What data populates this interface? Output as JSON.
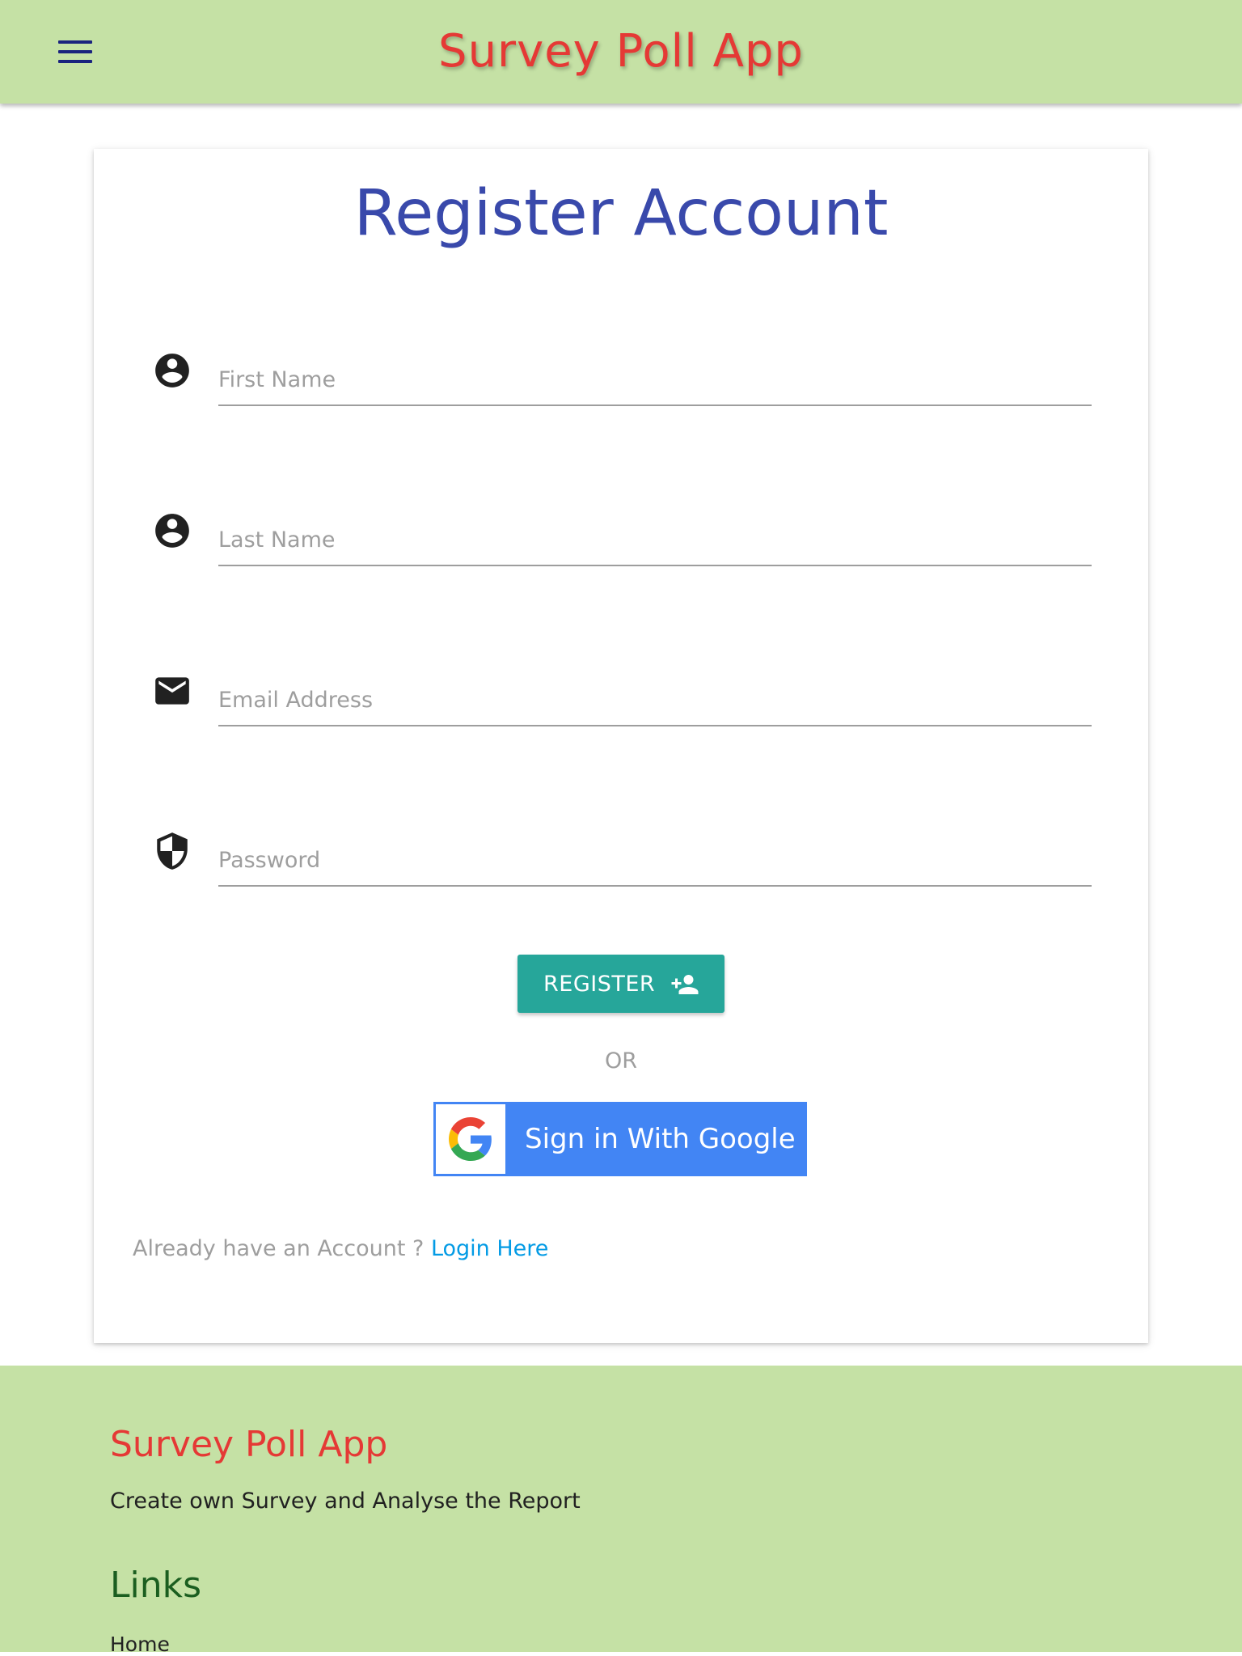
{
  "header": {
    "brand": "Survey Poll App",
    "menu_icon": "hamburger-menu-icon",
    "background_color": "#c5e1a5",
    "brand_color": "#e53935"
  },
  "form": {
    "title": "Register Account",
    "title_color": "#3949ab",
    "fields": [
      {
        "icon": "account-circle-icon",
        "placeholder": "First Name",
        "value": ""
      },
      {
        "icon": "account-circle-icon",
        "placeholder": "Last Name",
        "value": ""
      },
      {
        "icon": "email-icon",
        "placeholder": "Email Address",
        "value": ""
      },
      {
        "icon": "security-shield-icon",
        "placeholder": "Password",
        "value": ""
      }
    ],
    "register_label": "REGISTER",
    "register_icon": "person-add-icon",
    "register_color": "#26a69a",
    "or_text": "OR",
    "google_label": "Sign in With Google",
    "google_icon": "google-logo-icon",
    "google_color": "#4285f4",
    "login_prompt": "Already have an Account ?",
    "login_link": "Login Here",
    "link_color": "#039be5"
  },
  "footer": {
    "brand": "Survey Poll App",
    "description": "Create own Survey and Analyse the Report",
    "links_title": "Links",
    "links": [
      "Home"
    ]
  }
}
